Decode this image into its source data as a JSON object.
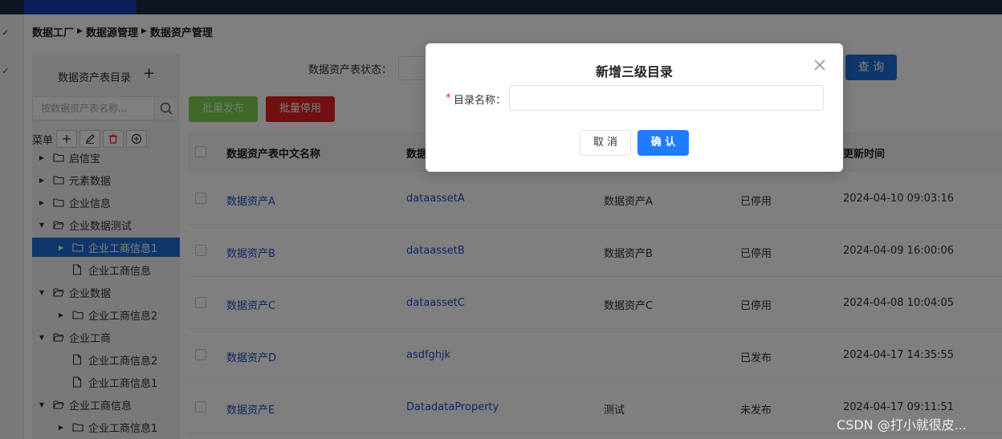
{
  "breadcrumb": [
    "数据工厂",
    "数据源管理",
    "数据资产管理"
  ],
  "tree": {
    "title": "数据资产表目录",
    "search_placeholder": "按数据资产表名称...",
    "toolbar_label": "菜单",
    "nodes": [
      {
        "label": "启信宝",
        "depth": 0,
        "arrow": "right",
        "icon": "folder-icon"
      },
      {
        "label": "元素数据",
        "depth": 0,
        "arrow": "right",
        "icon": "folder-icon"
      },
      {
        "label": "企业信息",
        "depth": 0,
        "arrow": "right",
        "icon": "folder-icon"
      },
      {
        "label": "企业数据测试",
        "depth": 0,
        "arrow": "down",
        "icon": "folder-open-icon"
      },
      {
        "label": "企业工商信息1",
        "depth": 1,
        "arrow": "right",
        "icon": "folder-icon",
        "selected": true
      },
      {
        "label": "企业工商信息",
        "depth": 1,
        "arrow": "none",
        "icon": "file-icon"
      },
      {
        "label": "企业数据",
        "depth": 0,
        "arrow": "down",
        "icon": "folder-open-icon"
      },
      {
        "label": "企业工商信息2",
        "depth": 1,
        "arrow": "right",
        "icon": "folder-icon"
      },
      {
        "label": "企业工商",
        "depth": 0,
        "arrow": "down",
        "icon": "folder-open-icon"
      },
      {
        "label": "企业工商信息2",
        "depth": 1,
        "arrow": "none",
        "icon": "file-icon"
      },
      {
        "label": "企业工商信息1",
        "depth": 1,
        "arrow": "none",
        "icon": "file-icon"
      },
      {
        "label": "企业工商信息",
        "depth": 0,
        "arrow": "down",
        "icon": "folder-open-icon"
      },
      {
        "label": "企业工商信息1",
        "depth": 1,
        "arrow": "right",
        "icon": "folder-icon"
      }
    ]
  },
  "filters": {
    "status_label": "数据资产表状态：",
    "query_label": "查 询"
  },
  "actions": {
    "batch_publish": "批量发布",
    "batch_disable": "批量停用"
  },
  "table": {
    "headers": [
      "数据资产表中文名称",
      "数据",
      "",
      "",
      "更新时间"
    ],
    "rows": [
      [
        "数据资产A",
        "dataassetA",
        "数据资产A",
        "已停用",
        "2024-04-10 09:03:16"
      ],
      [
        "数据资产B",
        "dataassetB",
        "数据资产B",
        "已停用",
        "2024-04-09 16:00:06"
      ],
      [
        "数据资产C",
        "dataassetC",
        "数据资产C",
        "已停用",
        "2024-04-08 10:04:05"
      ],
      [
        "数据资产D",
        "asdfghjk",
        "",
        "已发布",
        "2024-04-17 14:35:55"
      ],
      [
        "数据资产E",
        "DatadataProperty",
        "测试",
        "未发布",
        "2024-04-17 09:11:51"
      ]
    ]
  },
  "dialog": {
    "title": "新增三级目录",
    "field_label": "目录名称：",
    "required_mark": "*",
    "field_value": "",
    "cancel_label": "取 消",
    "ok_label": "确 认"
  },
  "watermark": "CSDN @打小就很皮...",
  "colors": {
    "primary": "#1f7cff",
    "selected": "#1f6fd6",
    "danger": "#e02020",
    "success": "#52c41a",
    "topbar": "#1e2a44"
  }
}
